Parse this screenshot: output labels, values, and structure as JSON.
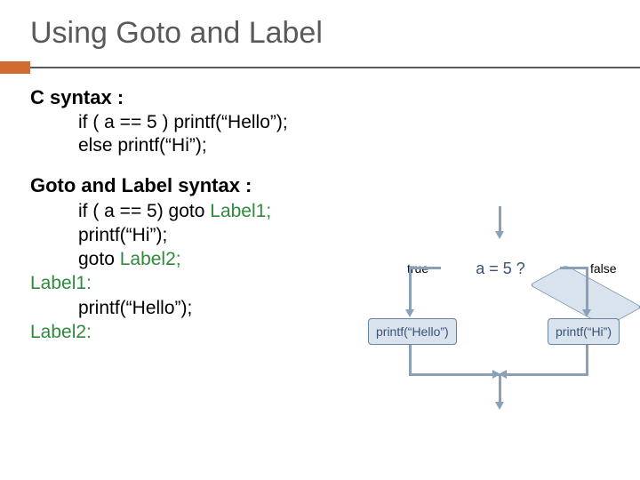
{
  "title": "Using Goto and Label",
  "section1": {
    "heading": "C syntax :",
    "line1": "if ( a == 5 ) printf(“Hello”);",
    "line2": "else  printf(“Hi”);"
  },
  "section2": {
    "heading": "Goto and Label syntax :",
    "l1": "if ( a == 5)   goto  ",
    "l1g": "Label1;",
    "l2": "printf(“Hi”);",
    "l3a": "goto ",
    "l3g": "Label2;",
    "l4g": "Label1:",
    "l5": "printf(“Hello”);",
    "l6g": "Label2:"
  },
  "flow": {
    "cond": "a = 5 ?",
    "true": "true",
    "false": "false",
    "left": "printf(“Hello”)",
    "right": "printf(“Hi”)"
  }
}
